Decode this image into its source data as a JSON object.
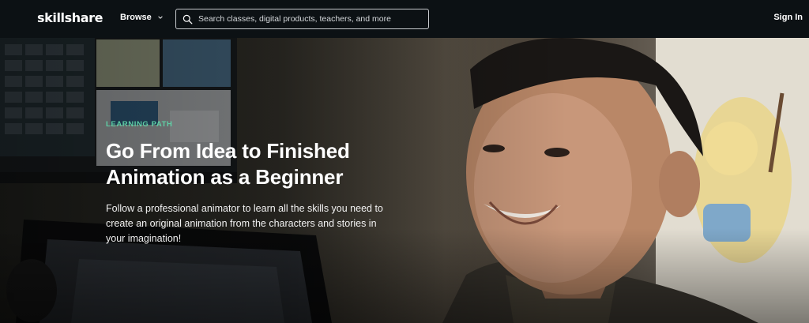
{
  "header": {
    "logo": "skillshare",
    "browse_label": "Browse",
    "search": {
      "placeholder": "Search classes, digital products, teachers, and more",
      "value": ""
    },
    "signin_label": "Sign In"
  },
  "hero": {
    "eyebrow": "LEARNING PATH",
    "title": "Go From Idea to Finished Animation as a Beginner",
    "description": "Follow a professional animator to learn all the skills you need to create an original animation from the characters and stories in your imagination!"
  },
  "colors": {
    "nav_background": "#0c1114",
    "accent": "#5fd0a6",
    "text": "#ffffff"
  },
  "icons": {
    "browse_chevron": "chevron-down-icon",
    "search": "search-icon"
  }
}
